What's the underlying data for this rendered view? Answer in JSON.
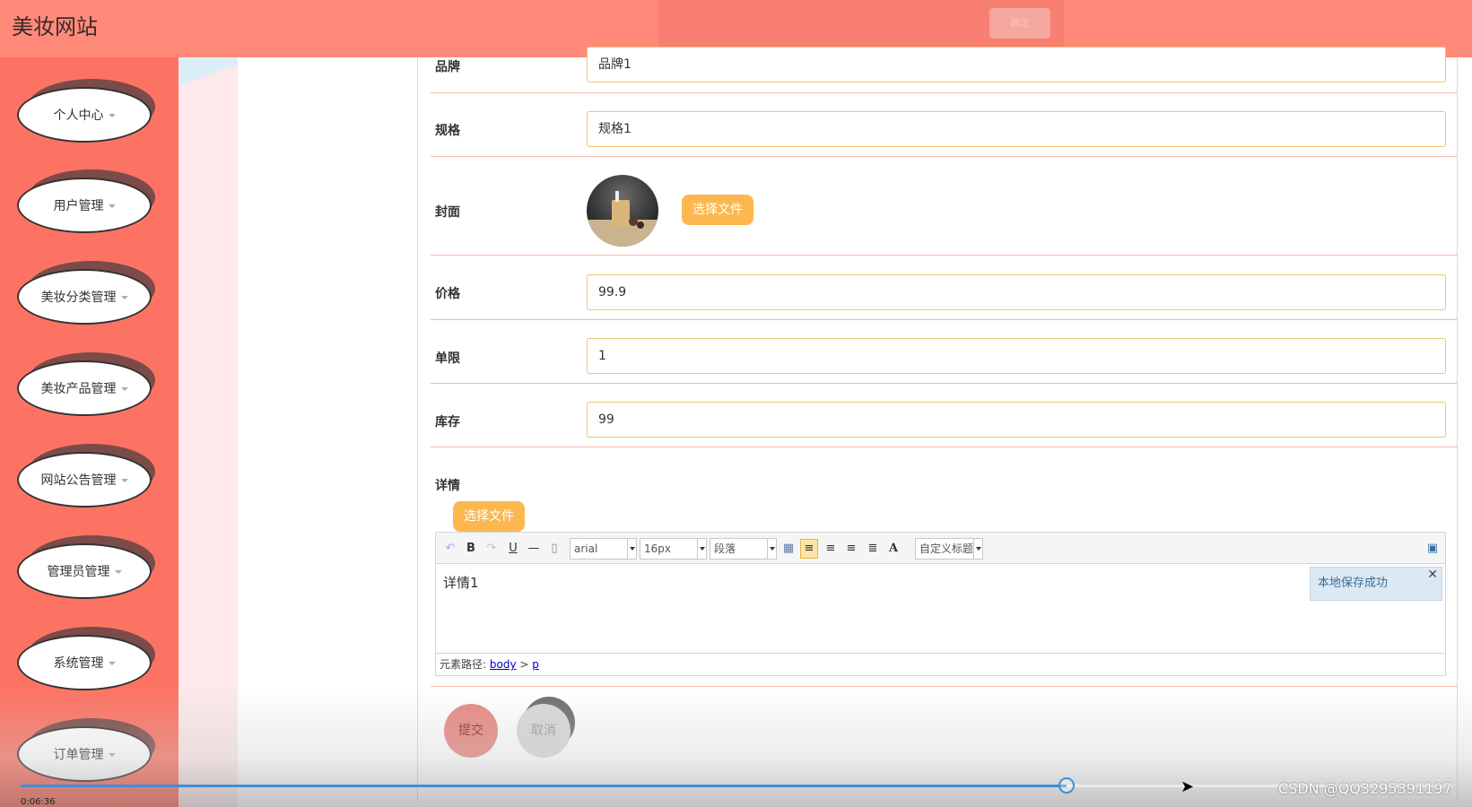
{
  "header": {
    "site_title": "美妆网站",
    "faded_button_label": "确定"
  },
  "sidebar": {
    "items": [
      {
        "label": "个人中心"
      },
      {
        "label": "用户管理"
      },
      {
        "label": "美妆分类管理"
      },
      {
        "label": "美妆产品管理"
      },
      {
        "label": "网站公告管理"
      },
      {
        "label": "管理员管理"
      },
      {
        "label": "系统管理"
      },
      {
        "label": "订单管理"
      }
    ]
  },
  "form": {
    "brand": {
      "label": "品牌",
      "value": "品牌1"
    },
    "spec": {
      "label": "规格",
      "value": "规格1"
    },
    "cover": {
      "label": "封面",
      "button_label": "选择文件"
    },
    "price": {
      "label": "价格",
      "value": "99.9"
    },
    "limit": {
      "label": "单限",
      "value": "1"
    },
    "stock": {
      "label": "库存",
      "value": "99"
    },
    "detail": {
      "label": "详情",
      "button_label": "选择文件"
    }
  },
  "editor": {
    "font_family": "arial",
    "font_size": "16px",
    "paragraph": "段落",
    "custom_heading": "自定义标题",
    "content": "详情1",
    "toast": "本地保存成功",
    "path_prefix": "元素路径:",
    "path_body": "body",
    "path_sep": ">",
    "path_p": "p"
  },
  "actions": {
    "submit_label": "提交",
    "cancel_label": "取消"
  },
  "video": {
    "progress_fraction": 0.73,
    "time": "0:06:36",
    "watermark": "CSDN @QQ3295391197"
  },
  "colors": {
    "header": "#ff8a7a",
    "sidebar": "#fd7363",
    "accent_button": "#fcb84f",
    "input_border": "#f1c373",
    "progress": "#3d8fd6"
  }
}
